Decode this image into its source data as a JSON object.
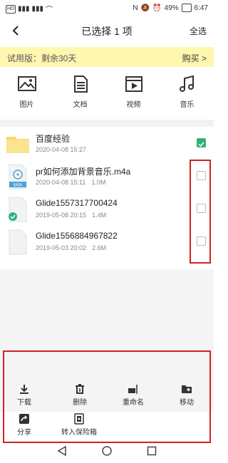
{
  "status": {
    "left": "HD 4G 4G",
    "battery": "49%",
    "time": "6:47"
  },
  "header": {
    "back_icon": "back-arrow-icon",
    "title": "已选择 1 项",
    "select_all": "全选"
  },
  "trial": {
    "text": "试用版：剩余30天",
    "buy": "购买 >"
  },
  "categories": [
    {
      "label": "图片",
      "icon": "image-icon"
    },
    {
      "label": "文档",
      "icon": "document-icon"
    },
    {
      "label": "视频",
      "icon": "video-icon"
    },
    {
      "label": "音乐",
      "icon": "music-icon"
    }
  ],
  "files": [
    {
      "name": "百度经验",
      "date": "2020-04-08 15:27",
      "size": "",
      "type": "folder",
      "checked": true
    },
    {
      "name": "pr如何添加背景音乐.m4a",
      "date": "2020-04-08 15:11",
      "size": "1.0M",
      "type": "m4a",
      "badge": "M4A",
      "checked": false
    },
    {
      "name": "Glide1557317700424",
      "date": "2019-05-08 20:15",
      "size": "1.4M",
      "type": "file-done",
      "checked": false
    },
    {
      "name": "Glide1556884967822",
      "date": "2019-05-03 20:02",
      "size": "2.6M",
      "type": "file",
      "checked": false
    }
  ],
  "actions": {
    "download": "下载",
    "delete": "删除",
    "rename": "重命名",
    "move": "移动",
    "share": "分享",
    "vault": "转入保险箱"
  },
  "colors": {
    "accent": "#2fb37a",
    "trial_bg": "#fff6b0",
    "highlight": "#d32020"
  }
}
